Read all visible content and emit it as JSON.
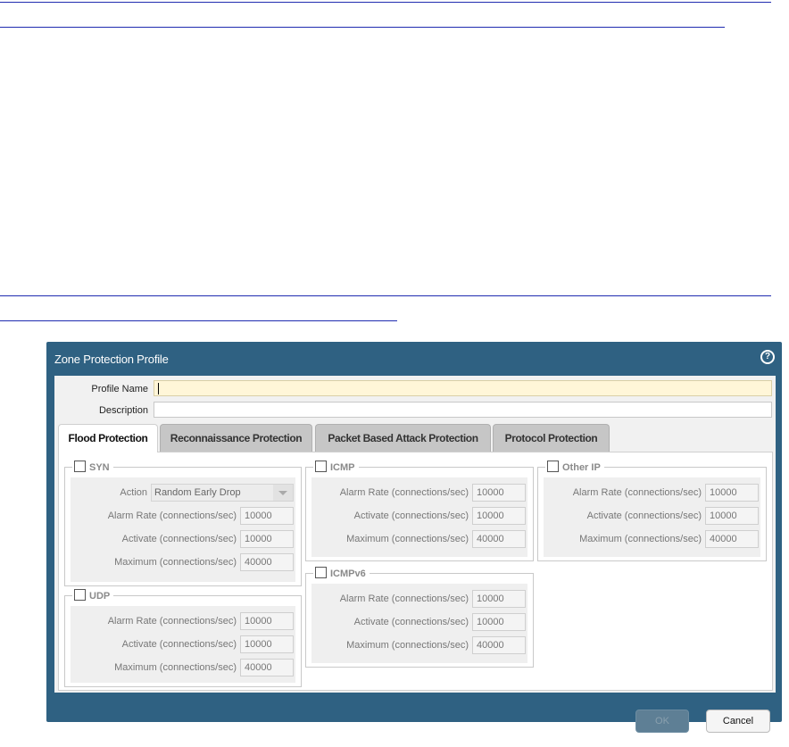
{
  "dialog": {
    "title": "Zone Protection Profile",
    "help_icon": "help-icon"
  },
  "form": {
    "profile_name_label": "Profile Name",
    "profile_name_value": "",
    "description_label": "Description",
    "description_value": ""
  },
  "tabs": [
    {
      "label": "Flood Protection",
      "active": true
    },
    {
      "label": "Reconnaissance Protection",
      "active": false
    },
    {
      "label": "Packet Based Attack Protection",
      "active": false
    },
    {
      "label": "Protocol Protection",
      "active": false
    }
  ],
  "groups": {
    "syn": {
      "title": "SYN",
      "action_label": "Action",
      "action_value": "Random Early Drop",
      "alarm_label": "Alarm Rate (connections/sec)",
      "alarm_value": "10000",
      "activate_label": "Activate (connections/sec)",
      "activate_value": "10000",
      "maximum_label": "Maximum (connections/sec)",
      "maximum_value": "40000"
    },
    "udp": {
      "title": "UDP",
      "alarm_label": "Alarm Rate (connections/sec)",
      "alarm_value": "10000",
      "activate_label": "Activate (connections/sec)",
      "activate_value": "10000",
      "maximum_label": "Maximum (connections/sec)",
      "maximum_value": "40000"
    },
    "icmp": {
      "title": "ICMP",
      "alarm_label": "Alarm Rate (connections/sec)",
      "alarm_value": "10000",
      "activate_label": "Activate (connections/sec)",
      "activate_value": "10000",
      "maximum_label": "Maximum (connections/sec)",
      "maximum_value": "40000"
    },
    "icmpv6": {
      "title": "ICMPv6",
      "alarm_label": "Alarm Rate (connections/sec)",
      "alarm_value": "10000",
      "activate_label": "Activate (connections/sec)",
      "activate_value": "10000",
      "maximum_label": "Maximum (connections/sec)",
      "maximum_value": "40000"
    },
    "other_ip": {
      "title": "Other IP",
      "alarm_label": "Alarm Rate (connections/sec)",
      "alarm_value": "10000",
      "activate_label": "Activate (connections/sec)",
      "activate_value": "10000",
      "maximum_label": "Maximum (connections/sec)",
      "maximum_value": "40000"
    }
  },
  "buttons": {
    "ok_label": "OK",
    "cancel_label": "Cancel"
  },
  "colors": {
    "dialog_bg": "#2f6182",
    "focused_input_bg": "#fff6d8",
    "link_line": "#1f2bb0"
  }
}
